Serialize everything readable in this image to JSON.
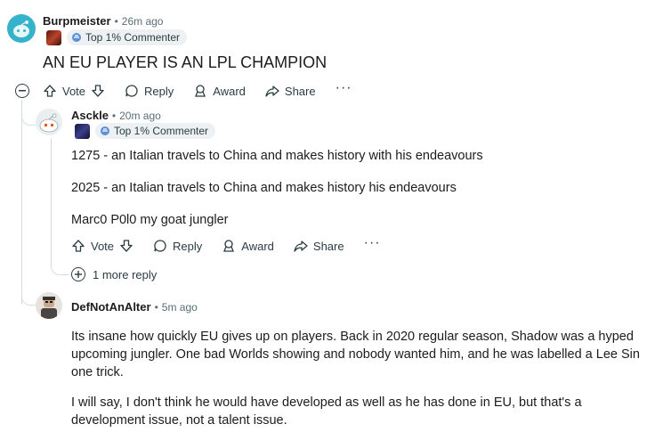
{
  "comments": [
    {
      "username": "Burpmeister",
      "time": "26m ago",
      "badge": "Top 1% Commenter",
      "body": [
        "AN EU PLAYER IS AN LPL CHAMPION"
      ],
      "actions": {
        "vote": "Vote",
        "reply": "Reply",
        "award": "Award",
        "share": "Share",
        "more": "···"
      }
    },
    {
      "username": "Asckle",
      "time": "20m ago",
      "badge": "Top 1% Commenter",
      "body": [
        "1275 - an Italian travels to China and makes history with his endeavours",
        "2025 - an Italian travels to China and makes history his endeavours",
        "Marc0 P0l0 my goat jungler"
      ],
      "actions": {
        "vote": "Vote",
        "reply": "Reply",
        "award": "Award",
        "share": "Share",
        "more": "···"
      },
      "more_replies": "1 more reply"
    },
    {
      "username": "DefNotAnAlter",
      "time": "5m ago",
      "body": [
        "Its insane how quickly EU gives up on players. Back in 2020 regular season, Shadow was a hyped upcoming jungler. One bad Worlds showing and nobody wanted him, and he was labelled a Lee Sin one trick.",
        "I will say, I don't think he would have developed as well as he has done in EU, but that's a development issue, not a talent issue."
      ]
    }
  ],
  "colors": {
    "accent": "#24a0b5",
    "text": "#1c1c1c",
    "muted": "#576f76",
    "thread_line": "#d6dde0"
  }
}
